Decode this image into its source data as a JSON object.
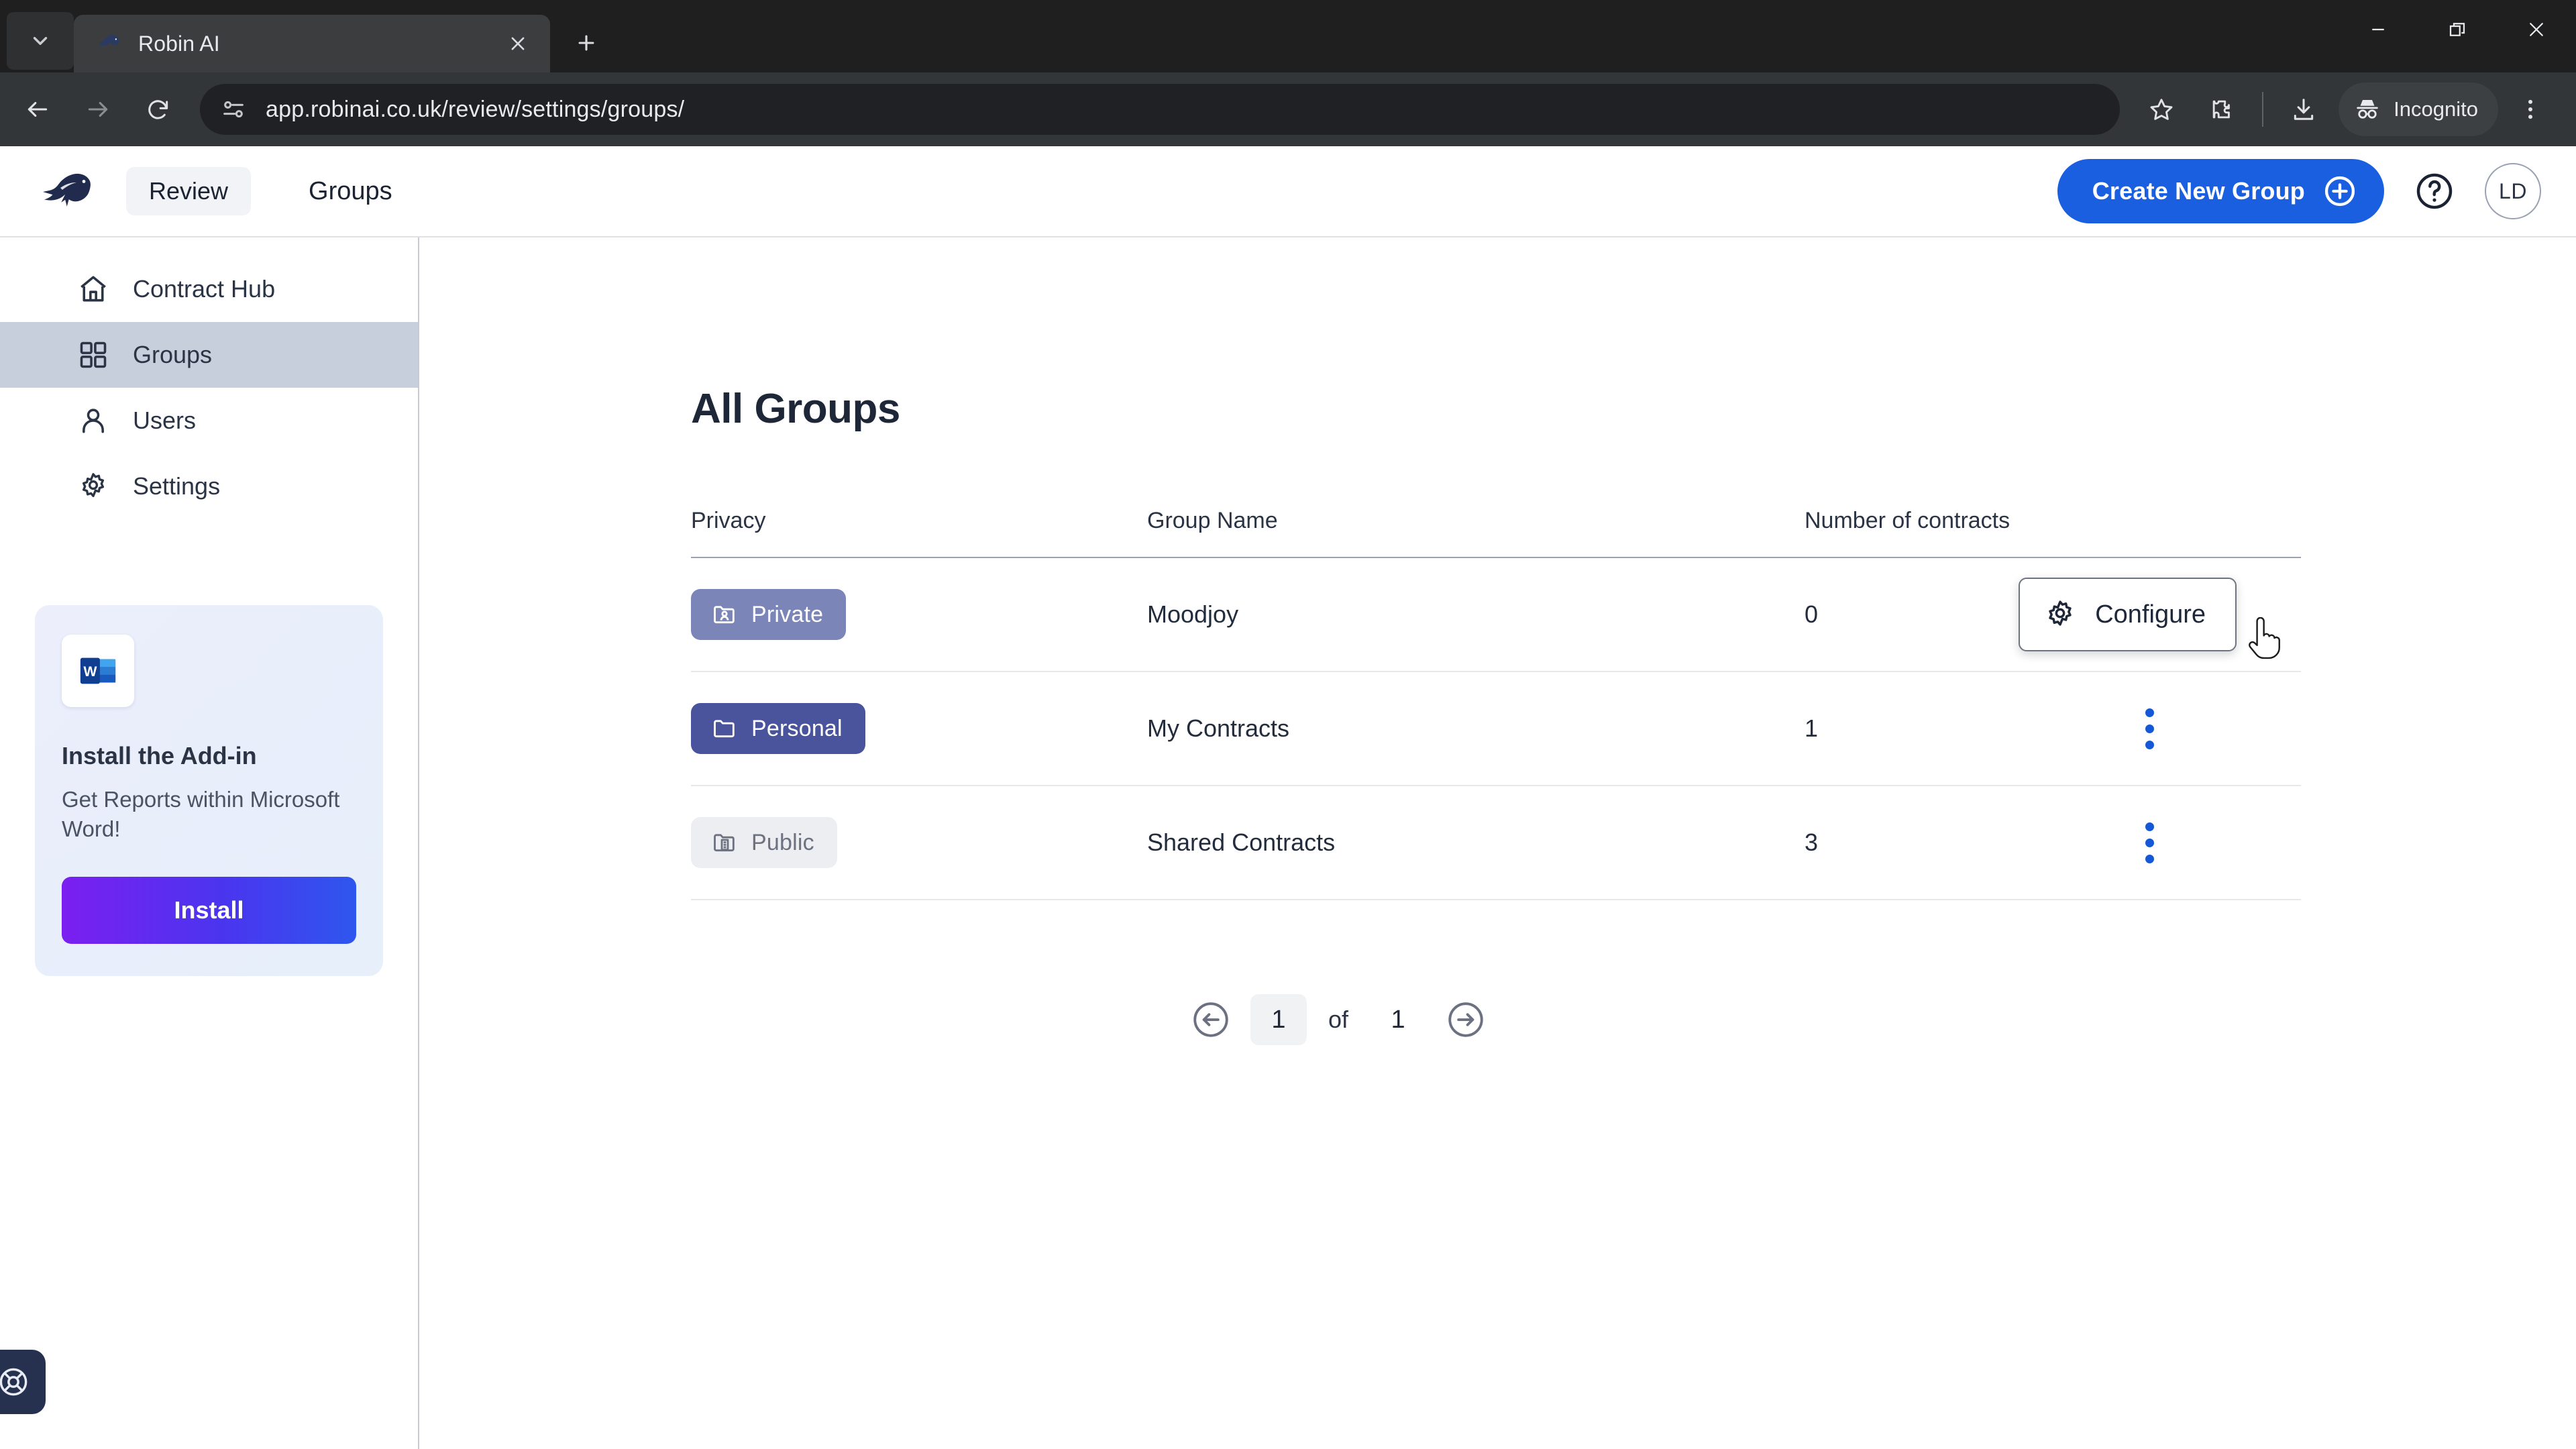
{
  "browser": {
    "tab": {
      "title": "Robin AI",
      "favicon_icon": "robin-bird-icon"
    },
    "tab_list_icon": "chevron-down-icon",
    "new_tab_icon": "plus-icon",
    "close_tab_icon": "close-icon",
    "back_icon": "arrow-left-icon",
    "forward_icon": "arrow-right-icon",
    "reload_icon": "reload-icon",
    "site_info_icon": "tune-sliders-icon",
    "url": "app.robinai.co.uk/review/settings/groups/",
    "bookmark_icon": "star-icon",
    "extensions_icon": "puzzle-piece-icon",
    "downloads_icon": "download-icon",
    "incognito_label": "Incognito",
    "incognito_icon": "incognito-hat-icon",
    "menu_icon": "three-dots-vertical-icon",
    "minimize_icon": "minimize-icon",
    "maximize_icon": "restore-window-icon",
    "close_window_icon": "close-window-icon"
  },
  "app_header": {
    "logo_icon": "robin-bird-logo",
    "product_tab": "Review",
    "breadcrumb": "Groups",
    "create_button": "Create New Group",
    "create_button_icon": "plus-circle-icon",
    "create_button_color": "#1a5fe0",
    "help_icon": "question-circle-icon",
    "avatar_initials": "LD"
  },
  "sidebar": {
    "items": [
      {
        "label": "Contract Hub",
        "icon": "home-icon",
        "active": false
      },
      {
        "label": "Groups",
        "icon": "grid-squares-icon",
        "active": true
      },
      {
        "label": "Users",
        "icon": "user-icon",
        "active": false
      },
      {
        "label": "Settings",
        "icon": "gear-icon",
        "active": false
      }
    ],
    "active_item_color": "#c7cfdd",
    "promo": {
      "app_icon": "microsoft-word-icon",
      "title": "Install the Add-in",
      "subtitle": "Get Reports within Microsoft Word!",
      "button": "Install"
    },
    "help_fab_icon": "lifebuoy-support-icon"
  },
  "main": {
    "title": "All Groups",
    "table": {
      "columns": [
        "Privacy",
        "Group Name",
        "Number of contracts"
      ],
      "rows": [
        {
          "privacy": "Private",
          "privacy_icon": "folder-person-icon",
          "name": "Moodjoy",
          "count": "0",
          "menu_icon": "kebab-menu-icon"
        },
        {
          "privacy": "Personal",
          "privacy_icon": "folder-icon",
          "name": "My Contracts",
          "count": "1",
          "menu_icon": "kebab-menu-icon"
        },
        {
          "privacy": "Public",
          "privacy_icon": "folder-building-icon",
          "name": "Shared Contracts",
          "count": "3",
          "menu_icon": "kebab-menu-icon"
        }
      ]
    },
    "context_menu": {
      "label": "Configure",
      "icon": "gear-icon"
    },
    "pagination": {
      "prev_icon": "arrow-left-circle-icon",
      "next_icon": "arrow-right-circle-icon",
      "current_page": "1",
      "separator": "of",
      "total_pages": "1"
    }
  }
}
